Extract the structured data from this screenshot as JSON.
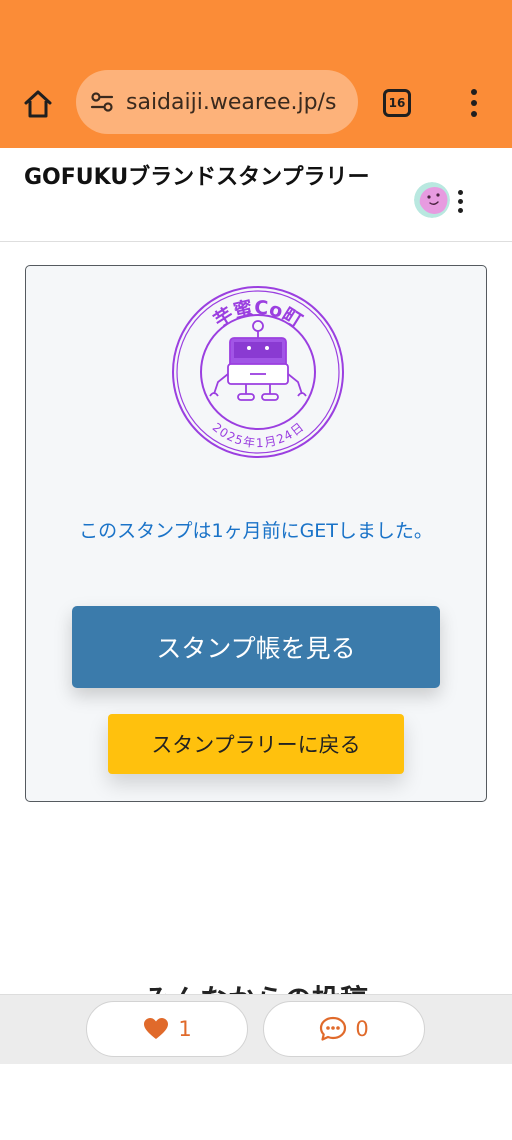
{
  "browser": {
    "url": "saidaiji.wearee.jp/s",
    "tab_count": "16",
    "chrome_color": "#fb8c37"
  },
  "app": {
    "title": "GOFUKUブランドスタンプラリー"
  },
  "stamp": {
    "name": "芋蜜Co町",
    "date": "2025年1月24日",
    "color": "#9b3fe0"
  },
  "card": {
    "message": "このスタンプは1ヶ月前にGETしました。",
    "primary_button": "スタンプ帳を見る",
    "secondary_button": "スタンプラリーに戻る",
    "primary_color": "#3b7bab",
    "secondary_color": "#ffc10d"
  },
  "section": {
    "heading": "みんなからの投稿"
  },
  "reactions": {
    "likes": "1",
    "comments": "0",
    "accent": "#e06a2b"
  },
  "icons": [
    "home-icon",
    "tune-icon",
    "tabs-icon",
    "more-vert-icon",
    "avatar",
    "heart-icon",
    "comment-icon"
  ]
}
